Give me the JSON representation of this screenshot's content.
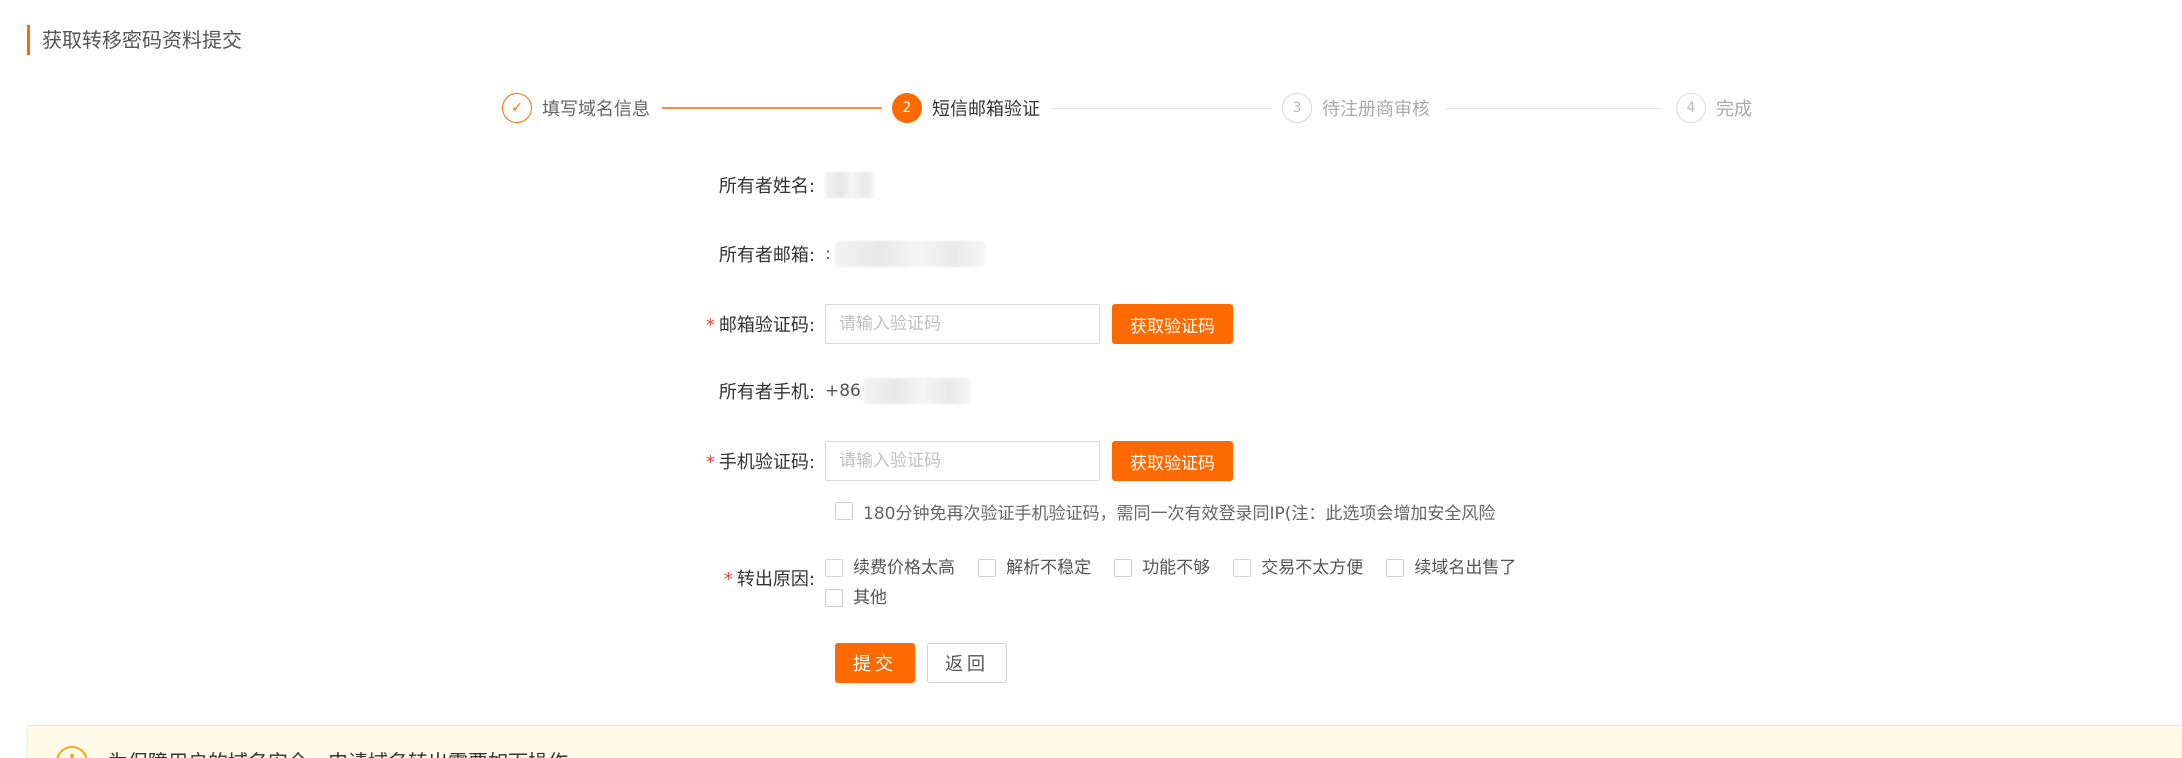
{
  "page": {
    "title": "获取转移密码资料提交"
  },
  "steps": [
    {
      "index": "✓",
      "label": "填写域名信息",
      "state": "done"
    },
    {
      "index": "2",
      "label": "短信邮箱验证",
      "state": "active"
    },
    {
      "index": "3",
      "label": "待注册商审核",
      "state": "pending"
    },
    {
      "index": "4",
      "label": "完成",
      "state": "pending"
    }
  ],
  "form": {
    "owner_name_label": "所有者姓名:",
    "owner_email_label": "所有者邮箱:",
    "owner_email_prefix": ":",
    "email_code_label": "邮箱验证码:",
    "email_code_placeholder": "请输入验证码",
    "email_code_button": "获取验证码",
    "owner_phone_label": "所有者手机:",
    "owner_phone_prefix": "+86",
    "phone_code_label": "手机验证码:",
    "phone_code_placeholder": "请输入验证码",
    "phone_code_button": "获取验证码",
    "skip_verify_text": "180分钟免再次验证手机验证码，需同一次有效登录同IP(注：此选项会增加安全风险",
    "reason_label": "转出原因:",
    "reasons": [
      "续费价格太高",
      "解析不稳定",
      "功能不够",
      "交易不太方便",
      "续域名出售了",
      "其他"
    ],
    "required_mark": "*",
    "submit_label": "提交",
    "back_label": "返回"
  },
  "notice": {
    "icon": "warning-icon",
    "text": "为保障用户的域名安全，申请域名转出需要如下操作:"
  },
  "colors": {
    "accent": "#ff6a00",
    "required": "#e8463b",
    "notice_bg": "#fffbe8"
  }
}
